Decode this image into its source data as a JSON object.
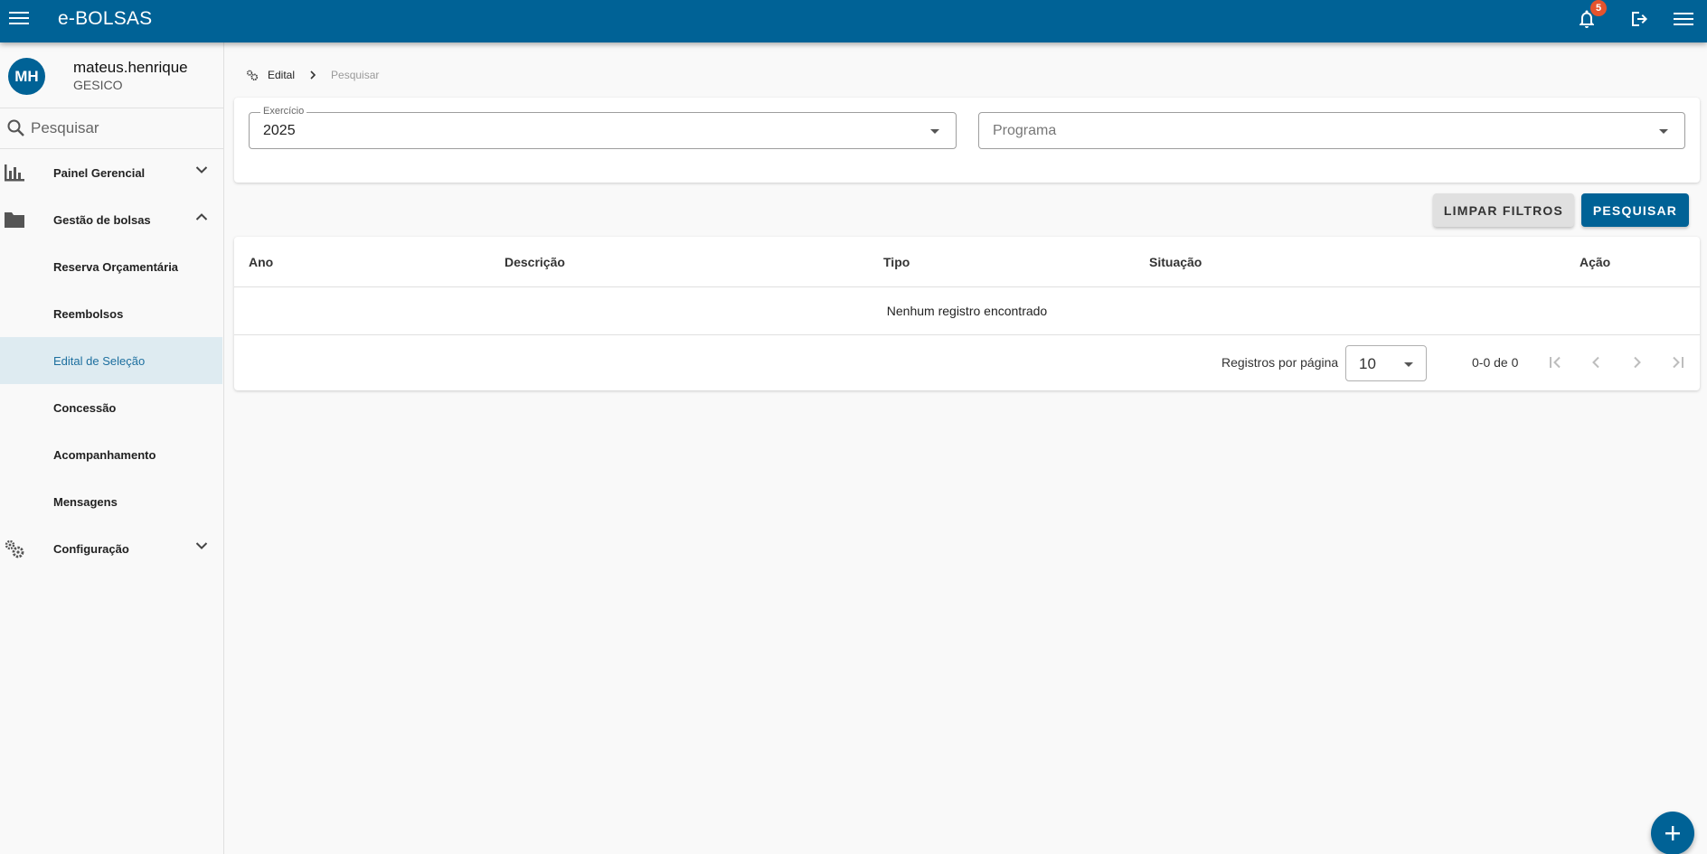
{
  "app": {
    "title": "e-BOLSAS",
    "notification_count": "5"
  },
  "user": {
    "initials": "MH",
    "name": "mateus.henrique",
    "org": "GESICO"
  },
  "sidebar": {
    "search_placeholder": "Pesquisar",
    "groups": [
      {
        "label": "Painel Gerencial",
        "icon": "bar-chart-icon",
        "expanded": false
      },
      {
        "label": "Gestão de bolsas",
        "icon": "folder-icon",
        "expanded": true,
        "items": [
          {
            "label": "Reserva Orçamentária"
          },
          {
            "label": "Reembolsos"
          },
          {
            "label": "Edital de Seleção",
            "active": true
          },
          {
            "label": "Concessão"
          },
          {
            "label": "Acompanhamento"
          },
          {
            "label": "Mensagens"
          }
        ]
      },
      {
        "label": "Configuração",
        "icon": "gears-icon",
        "expanded": false
      }
    ]
  },
  "breadcrumb": {
    "parent": "Edital",
    "current": "Pesquisar"
  },
  "filters": {
    "exercicio": {
      "label": "Exercício",
      "value": "2025"
    },
    "programa": {
      "placeholder": "Programa"
    }
  },
  "actions": {
    "clear_label": "LIMPAR FILTROS",
    "search_label": "PESQUISAR"
  },
  "table": {
    "columns": [
      "Ano",
      "Descrição",
      "Tipo",
      "Situação",
      "Ação"
    ],
    "empty_message": "Nenhum registro encontrado"
  },
  "pagination": {
    "rows_per_page_label": "Registros por página",
    "rows_per_page": "10",
    "range": "0-0 de 0"
  },
  "colors": {
    "primary": "#006296",
    "badge": "#e5532d",
    "active_bg": "#deebf1"
  }
}
